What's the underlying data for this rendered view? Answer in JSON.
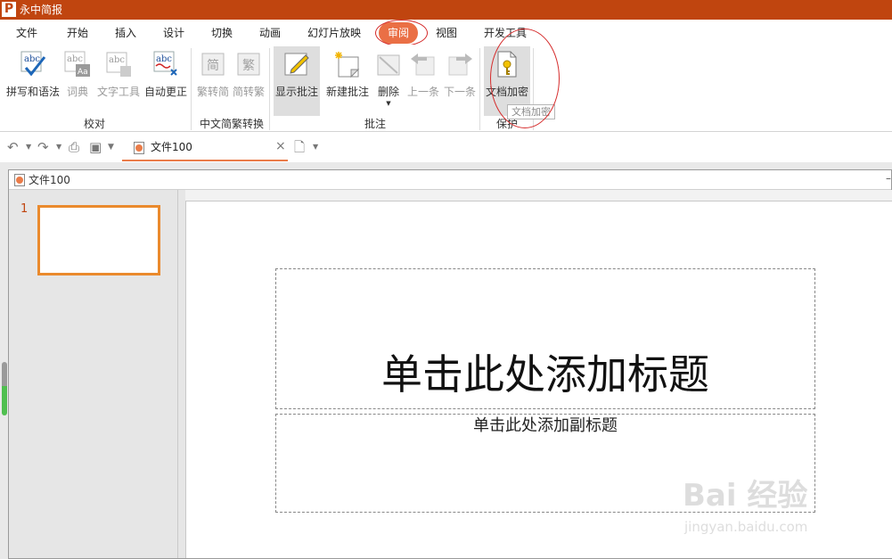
{
  "app": {
    "logo": "P",
    "title": "永中简报"
  },
  "menu": {
    "tabs": [
      "文件",
      "开始",
      "插入",
      "设计",
      "切换",
      "动画",
      "幻灯片放映",
      "审阅",
      "视图",
      "开发工具"
    ],
    "active": "审阅"
  },
  "ribbon": {
    "buttons": {
      "spelling": "拼写和语法",
      "dictionary": "词典",
      "text_tools": "文字工具",
      "autocorrect": "自动更正",
      "trad_to_simp": "繁转简",
      "simp_to_trad": "简转繁",
      "show_comments": "显示批注",
      "new_comment": "新建批注",
      "delete": "删除",
      "previous": "上一条",
      "next": "下一条",
      "encrypt": "文档加密"
    },
    "icon_text": {
      "abc": "abc",
      "aa": "Aa",
      "simp": "简",
      "trad": "繁"
    },
    "groups": {
      "proofing": "校对",
      "chinese_conversion": "中文简繁转换",
      "comments": "批注",
      "protect": "保护"
    },
    "tooltip": "文档加密"
  },
  "toolbar": {
    "doc_tab": "文件100"
  },
  "document": {
    "window_title": "文件100",
    "slide_number": "1",
    "title_placeholder": "单击此处添加标题",
    "subtitle_placeholder": "单击此处添加副标题"
  },
  "watermark": {
    "main": "Bai 经验",
    "sub": "jingyan.baidu.com"
  },
  "colors": {
    "brand": "#c0450f",
    "active_tab": "#ea6f45",
    "thumb_border": "#ea8a2d",
    "annotation": "#d52b2b"
  }
}
